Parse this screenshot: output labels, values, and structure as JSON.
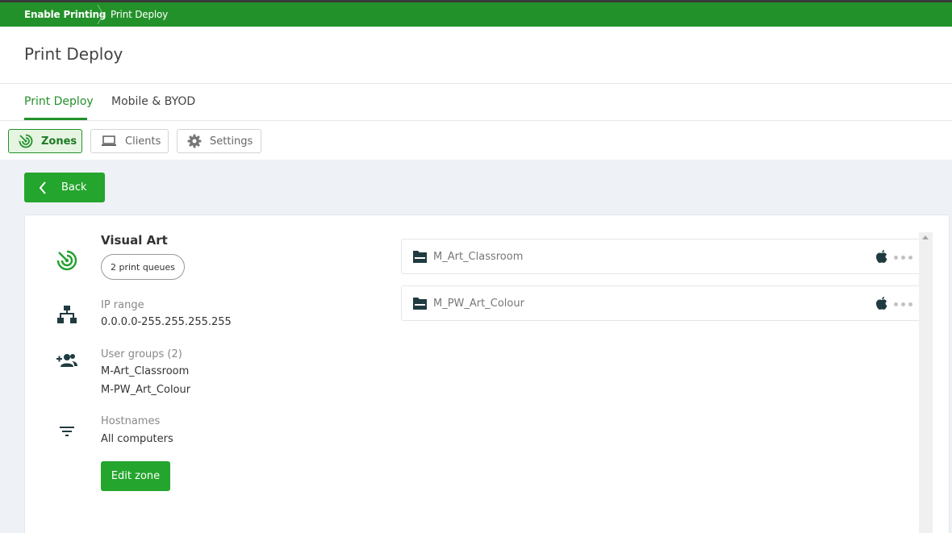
{
  "breadcrumb": {
    "items": [
      "Enable Printing",
      "Print Deploy"
    ]
  },
  "page": {
    "title": "Print Deploy"
  },
  "tabs": [
    {
      "label": "Print Deploy",
      "active": true
    },
    {
      "label": "Mobile & BYOD",
      "active": false
    }
  ],
  "subnav": [
    {
      "label": "Zones",
      "icon": "zones-icon",
      "active": true
    },
    {
      "label": "Clients",
      "icon": "laptop-icon",
      "active": false
    },
    {
      "label": "Settings",
      "icon": "gear-icon",
      "active": false
    }
  ],
  "back_label": "Back",
  "zone": {
    "name": "Visual Art",
    "queue_count_label": "2 print queues",
    "ip_range_label": "IP range",
    "ip_range_value": "0.0.0.0-255.255.255.255",
    "user_groups_label": "User groups (2)",
    "user_groups": [
      "M-Art_Classroom",
      "M-PW_Art_Colour"
    ],
    "hostnames_label": "Hostnames",
    "hostnames_value": "All computers",
    "edit_label": "Edit zone"
  },
  "queues": [
    {
      "name": "M_Art_Classroom",
      "platform_icon": "apple-icon"
    },
    {
      "name": "M_PW_Art_Colour",
      "platform_icon": "apple-icon"
    }
  ],
  "colors": {
    "brand_green": "#23912a",
    "button_green": "#24a52d",
    "icon_dark": "#1f3b40",
    "content_bg": "#eef1f5"
  }
}
